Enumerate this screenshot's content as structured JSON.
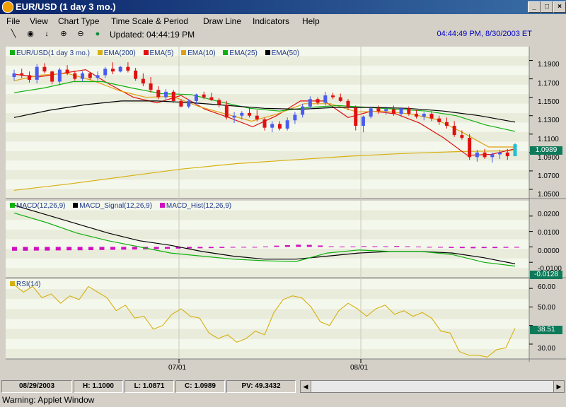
{
  "window": {
    "title": "EUR/USD (1 day  3 mo.)"
  },
  "menu": [
    "File",
    "View",
    "Chart Type",
    "Time Scale & Period",
    "Draw Line",
    "Indicators",
    "Help"
  ],
  "toolbar": {
    "updated": "Updated: 04:44:19 PM",
    "clock": "04:44:49 PM, 8/30/2003 ET"
  },
  "status": {
    "date": "08/29/2003",
    "high": "H: 1.1000",
    "low": "L: 1.0871",
    "close": "C: 1.0989",
    "pv": "PV: 49.3432"
  },
  "warning": "Warning: Applet Window",
  "colors": {
    "up": "#4a5cf0",
    "down": "#e01010",
    "ema200": "#d6b010",
    "ema5": "#e01010",
    "ema10": "#e0a010",
    "ema25": "#10b010",
    "ema50": "#000000",
    "hist": "#d010c0",
    "tag": "#0e7a5a"
  },
  "chart_data": [
    {
      "type": "candlestick",
      "legend": [
        "EUR/USD(1 day  3 mo.)",
        "EMA(200)",
        "EMA(5)",
        "EMA(10)",
        "EMA(25)",
        "EMA(50)"
      ],
      "ylim": [
        1.04,
        1.205
      ],
      "yticks": [
        "1.1900",
        "1.1700",
        "1.1500",
        "1.1300",
        "1.1100",
        "1.0900",
        "1.0700",
        "1.0500"
      ],
      "last_value": "1.0989",
      "xticks": [
        "07/01",
        "08/01"
      ],
      "candles": [
        [
          1.172,
          1.18,
          1.168,
          1.176
        ],
        [
          1.176,
          1.181,
          1.171,
          1.174
        ],
        [
          1.174,
          1.178,
          1.166,
          1.169
        ],
        [
          1.169,
          1.186,
          1.165,
          1.183
        ],
        [
          1.183,
          1.187,
          1.176,
          1.178
        ],
        [
          1.178,
          1.179,
          1.164,
          1.167
        ],
        [
          1.167,
          1.182,
          1.163,
          1.18
        ],
        [
          1.18,
          1.185,
          1.174,
          1.176
        ],
        [
          1.176,
          1.179,
          1.168,
          1.17
        ],
        [
          1.17,
          1.178,
          1.167,
          1.176
        ],
        [
          1.176,
          1.177,
          1.169,
          1.171
        ],
        [
          1.171,
          1.178,
          1.168,
          1.174
        ],
        [
          1.174,
          1.183,
          1.171,
          1.181
        ],
        [
          1.181,
          1.188,
          1.175,
          1.178
        ],
        [
          1.178,
          1.184,
          1.177,
          1.183
        ],
        [
          1.183,
          1.188,
          1.177,
          1.179
        ],
        [
          1.179,
          1.182,
          1.168,
          1.17
        ],
        [
          1.17,
          1.176,
          1.162,
          1.165
        ],
        [
          1.165,
          1.172,
          1.155,
          1.158
        ],
        [
          1.158,
          1.162,
          1.148,
          1.15
        ],
        [
          1.15,
          1.159,
          1.147,
          1.156
        ],
        [
          1.156,
          1.158,
          1.144,
          1.146
        ],
        [
          1.146,
          1.148,
          1.139,
          1.14
        ],
        [
          1.14,
          1.148,
          1.138,
          1.146
        ],
        [
          1.146,
          1.154,
          1.142,
          1.153
        ],
        [
          1.153,
          1.156,
          1.148,
          1.15
        ],
        [
          1.15,
          1.155,
          1.146,
          1.147
        ],
        [
          1.147,
          1.149,
          1.139,
          1.142
        ],
        [
          1.142,
          1.146,
          1.126,
          1.128
        ],
        [
          1.128,
          1.134,
          1.122,
          1.13
        ],
        [
          1.13,
          1.135,
          1.126,
          1.133
        ],
        [
          1.133,
          1.138,
          1.128,
          1.13
        ],
        [
          1.13,
          1.136,
          1.124,
          1.126
        ],
        [
          1.126,
          1.128,
          1.114,
          1.117
        ],
        [
          1.117,
          1.124,
          1.112,
          1.121
        ],
        [
          1.121,
          1.124,
          1.114,
          1.116
        ],
        [
          1.116,
          1.128,
          1.114,
          1.125
        ],
        [
          1.125,
          1.134,
          1.121,
          1.131
        ],
        [
          1.131,
          1.143,
          1.128,
          1.14
        ],
        [
          1.14,
          1.151,
          1.137,
          1.148
        ],
        [
          1.148,
          1.15,
          1.142,
          1.144
        ],
        [
          1.144,
          1.156,
          1.141,
          1.152
        ],
        [
          1.152,
          1.155,
          1.148,
          1.15
        ],
        [
          1.15,
          1.154,
          1.145,
          1.146
        ],
        [
          1.146,
          1.148,
          1.136,
          1.139
        ],
        [
          1.139,
          1.141,
          1.114,
          1.119
        ],
        [
          1.119,
          1.13,
          1.112,
          1.129
        ],
        [
          1.129,
          1.14,
          1.127,
          1.138
        ],
        [
          1.138,
          1.141,
          1.132,
          1.135
        ],
        [
          1.135,
          1.14,
          1.131,
          1.137
        ],
        [
          1.137,
          1.141,
          1.13,
          1.132
        ],
        [
          1.132,
          1.139,
          1.129,
          1.138
        ],
        [
          1.138,
          1.14,
          1.13,
          1.132
        ],
        [
          1.132,
          1.136,
          1.127,
          1.129
        ],
        [
          1.129,
          1.134,
          1.125,
          1.132
        ],
        [
          1.132,
          1.135,
          1.124,
          1.127
        ],
        [
          1.127,
          1.13,
          1.12,
          1.123
        ],
        [
          1.123,
          1.128,
          1.116,
          1.119
        ],
        [
          1.119,
          1.124,
          1.107,
          1.109
        ],
        [
          1.109,
          1.114,
          1.104,
          1.106
        ],
        [
          1.106,
          1.11,
          1.082,
          1.085
        ],
        [
          1.085,
          1.093,
          1.08,
          1.09
        ],
        [
          1.09,
          1.094,
          1.083,
          1.085
        ],
        [
          1.085,
          1.09,
          1.079,
          1.088
        ],
        [
          1.088,
          1.093,
          1.083,
          1.09
        ],
        [
          1.09,
          1.094,
          1.082,
          1.086
        ],
        [
          1.086,
          1.1,
          1.087,
          1.099
        ]
      ],
      "series": [
        {
          "name": "EMA(200)",
          "values": [
            1.049,
            1.056,
            1.064,
            1.072,
            1.078,
            1.082,
            1.086,
            1.089,
            1.091,
            1.092
          ]
        },
        {
          "name": "EMA(5)",
          "values": [
            1.175,
            1.172,
            1.176,
            1.18,
            1.164,
            1.15,
            1.144,
            1.152,
            1.137,
            1.128,
            1.118,
            1.13,
            1.146,
            1.146,
            1.128,
            1.135,
            1.132,
            1.122,
            1.106,
            1.087,
            1.088,
            1.094
          ]
        },
        {
          "name": "EMA(10)",
          "values": [
            1.168,
            1.174,
            1.176,
            1.168,
            1.157,
            1.15,
            1.151,
            1.14,
            1.132,
            1.124,
            1.132,
            1.143,
            1.143,
            1.134,
            1.135,
            1.132,
            1.126,
            1.112,
            1.096,
            1.096
          ]
        },
        {
          "name": "EMA(25)",
          "values": [
            1.155,
            1.16,
            1.167,
            1.167,
            1.16,
            1.154,
            1.153,
            1.145,
            1.138,
            1.135,
            1.139,
            1.141,
            1.139,
            1.137,
            1.135,
            1.13,
            1.12,
            1.113
          ]
        },
        {
          "name": "EMA(50)",
          "values": [
            1.128,
            1.136,
            1.142,
            1.146,
            1.146,
            1.144,
            1.141,
            1.138,
            1.137,
            1.139,
            1.139,
            1.138,
            1.135,
            1.13,
            1.123
          ]
        }
      ]
    },
    {
      "type": "line",
      "legend": [
        "MACD(12,26,9)",
        "MACD_Signal(12,26,9)",
        "MACD_Hist(12,26,9)"
      ],
      "ylim": [
        -0.02,
        0.03
      ],
      "yticks": [
        "0.0200",
        "0.0100",
        "0.0000",
        "-0.0100"
      ],
      "last_value": "-0.0128",
      "series": [
        {
          "name": "MACD(12,26,9)",
          "values": [
            0.022,
            0.016,
            0.009,
            0.004,
            0.0,
            -0.004,
            -0.006,
            -0.008,
            -0.009,
            -0.0095,
            -0.004,
            -0.002,
            -0.003,
            -0.003,
            -0.005,
            -0.01,
            -0.0125
          ]
        },
        {
          "name": "MACD_Signal(12,26,9)",
          "values": [
            0.027,
            0.021,
            0.015,
            0.009,
            0.004,
            0.001,
            -0.003,
            -0.006,
            -0.008,
            -0.008,
            -0.006,
            -0.004,
            -0.003,
            -0.003,
            -0.004,
            -0.007,
            -0.011
          ]
        },
        {
          "name": "MACD_Hist(12,26,9)",
          "values": [
            -0.0025,
            -0.0025,
            -0.0024,
            -0.0024,
            -0.0023,
            -0.0022,
            -0.0022,
            -0.0021,
            -0.002,
            -0.0019,
            -0.0018,
            -0.0017,
            -0.0016,
            -0.0014,
            -0.0012,
            -0.0011,
            -0.001,
            -0.0009,
            -0.0008,
            -0.0007,
            -0.0005,
            -0.0003,
            -0.0001,
            0.0003,
            0.0008,
            0.0011,
            0.0014,
            0.0013,
            0.0009,
            0.0004,
            0.0002,
            0.0003,
            0.0005,
            0.0004,
            0.0004,
            0.0006,
            0.0004,
            0.0002,
            -0.0002,
            -0.0005,
            -0.0007,
            -0.0008,
            -0.0009,
            -0.0008,
            -0.0008,
            -0.0006,
            -0.0005
          ]
        }
      ]
    },
    {
      "type": "line",
      "legend": [
        "RSI(14)"
      ],
      "ylim": [
        22,
        65
      ],
      "yticks": [
        "60.00",
        "50.00",
        "40.00",
        "30.00"
      ],
      "last_value": "38.51",
      "series": [
        {
          "name": "RSI(14)",
          "values": [
            62,
            58,
            61,
            55,
            57,
            52,
            56,
            54,
            61,
            58,
            55,
            48,
            51,
            44,
            45,
            38,
            40,
            46,
            49,
            45,
            44,
            36,
            33,
            35,
            31,
            33,
            37,
            35,
            47,
            54,
            56,
            55,
            50,
            42,
            40,
            48,
            52,
            49,
            45,
            49,
            51,
            46,
            48,
            45,
            47,
            44,
            37,
            36,
            26,
            24,
            24,
            23,
            27,
            28,
            38.51
          ]
        }
      ]
    }
  ]
}
